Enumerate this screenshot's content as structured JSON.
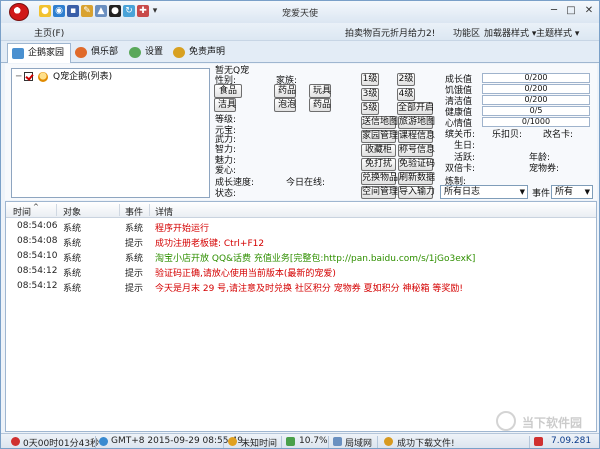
{
  "window": {
    "title": "宠爱天使"
  },
  "menubar": {
    "home": "主页(F)",
    "promo": "拍卖物百元折月给力2!",
    "functions": "功能区",
    "skin": "加载器样式 ▾",
    "theme": "主题样式 ▾"
  },
  "tabs": [
    {
      "label": "企鹅家园"
    },
    {
      "label": "俱乐部"
    },
    {
      "label": "设置"
    },
    {
      "label": "免责声明"
    }
  ],
  "tree": {
    "root_label": "Q宠企鹅(列表)"
  },
  "pet": {
    "heading": "暂无Q宠",
    "gender_label": "性别:",
    "family_label": "家族:",
    "level_label": "等级:",
    "yuanbao_label": "元宝:",
    "force_label": "武力:",
    "intel_label": "智力:",
    "charm_label": "魅力:",
    "love_label": "爱心:",
    "growth_speed_label": "成长速度:",
    "online_today_label": "今日在线:",
    "status_label": "状态:",
    "items": [
      "食品",
      "药品",
      "玩具",
      "洁具",
      "泡泡",
      "药品"
    ]
  },
  "grid": {
    "buttons": [
      "1级",
      "2级",
      "3级",
      "4级",
      "5级",
      "全部开启",
      "送信地图",
      "旅游地图",
      "家园管理",
      "课程信息",
      "收藏柜",
      "称号信息",
      "免打扰",
      "免验证码",
      "兑换物品",
      "刷新数据",
      "空间管理",
      "导入输力"
    ]
  },
  "stats": {
    "rows": [
      {
        "label": "成长值",
        "value": "0/200",
        "percent": 0
      },
      {
        "label": "饥饿值",
        "value": "0/200",
        "percent": 0
      },
      {
        "label": "清洁值",
        "value": "0/200",
        "percent": 0
      },
      {
        "label": "健康值",
        "value": "0/5",
        "percent": 0
      },
      {
        "label": "心情值",
        "value": "0/1000",
        "percent": 0
      }
    ],
    "coins_label": "缤关币:",
    "lepeach_label": "乐扣贝:",
    "qcard_label": "改名卡:",
    "birthday_label": "生日:",
    "activity_label": "活跃:",
    "age_label": "年龄:",
    "coupon_label": "双倍卡:",
    "petcoin_label": "宠物券:",
    "refine_label": "炼制:"
  },
  "filters": {
    "log_select": "所有日志",
    "event_label": "事件",
    "event_select": "所有"
  },
  "log": {
    "headers": {
      "time": "时间",
      "object": "对象",
      "event": "事件",
      "detail": "详情"
    },
    "rows": [
      {
        "time": "08:54:06",
        "object": "系统",
        "event": "系统",
        "detail": "程序开始运行",
        "color": "#d40000"
      },
      {
        "time": "08:54:08",
        "object": "系统",
        "event": "提示",
        "detail": "成功注册老板键: Ctrl+F12",
        "color": "#d40000"
      },
      {
        "time": "08:54:10",
        "object": "系统",
        "event": "系统",
        "detail": "淘宝小店开放 QQ&话费 充值业务[完整包:http://pan.baidu.com/s/1jGo3exK]",
        "color": "#2f8f00"
      },
      {
        "time": "08:54:12",
        "object": "系统",
        "event": "提示",
        "detail": "验证码正确,请放心使用当前版本(最新的宠爱)",
        "color": "#d40000"
      },
      {
        "time": "08:54:12",
        "object": "系统",
        "event": "提示",
        "detail": "今天是月末 29 号,请注意及时兑换 社区积分 宠物券 夏如积分 神秘箱 等奖励!",
        "color": "#d40000"
      }
    ]
  },
  "status": {
    "runtime": "0天00时01分43秒",
    "gmt": "GMT+8 2015-09-29 08:55:49",
    "unknown": "未知时间",
    "percent": "10.7%",
    "net": "局域网",
    "download": "成功下载文件!",
    "version": "7.09.281"
  },
  "watermark": {
    "text": "当下软件园"
  }
}
